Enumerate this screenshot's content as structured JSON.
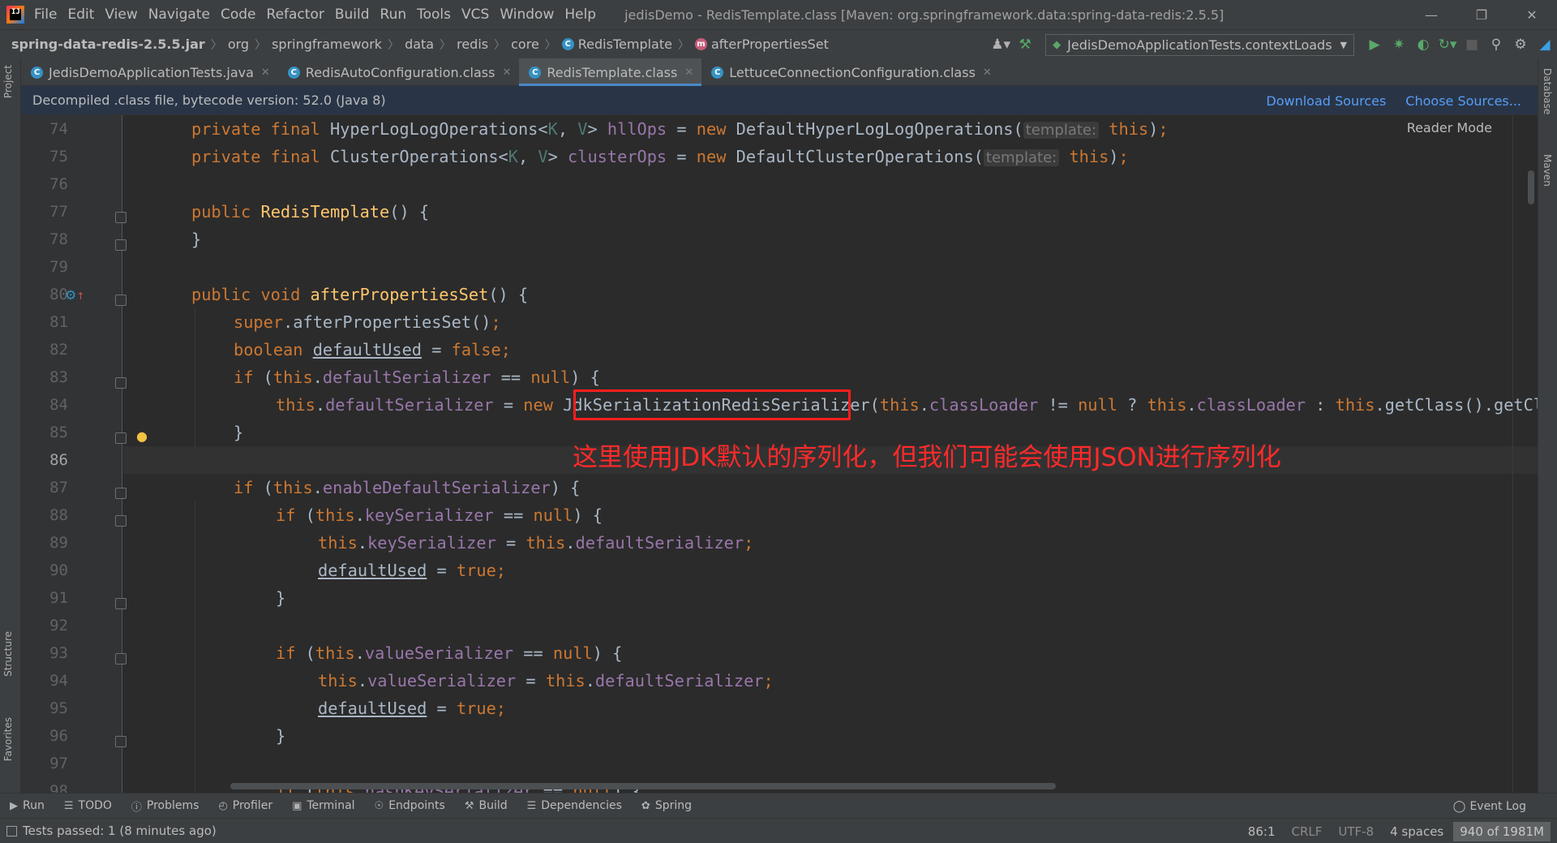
{
  "menubar": {
    "items": [
      "File",
      "Edit",
      "View",
      "Navigate",
      "Code",
      "Refactor",
      "Build",
      "Run",
      "Tools",
      "VCS",
      "Window",
      "Help"
    ],
    "title": "jedisDemo - RedisTemplate.class [Maven: org.springframework.data:spring-data-redis:2.5.5]"
  },
  "breadcrumb": {
    "items": [
      "spring-data-redis-2.5.5.jar",
      "org",
      "springframework",
      "data",
      "redis",
      "core",
      "RedisTemplate",
      "afterPropertiesSet"
    ]
  },
  "run_config": {
    "label": "JedisDemoApplicationTests.contextLoads"
  },
  "tabs": [
    {
      "label": "JedisDemoApplicationTests.java"
    },
    {
      "label": "RedisAutoConfiguration.class"
    },
    {
      "label": "RedisTemplate.class"
    },
    {
      "label": "LettuceConnectionConfiguration.class"
    }
  ],
  "banner": {
    "text": "Decompiled .class file, bytecode version: 52.0 (Java 8)",
    "download": "Download Sources",
    "choose": "Choose Sources..."
  },
  "reader_mode": "Reader Mode",
  "side_tabs": {
    "project": "Project",
    "structure": "Structure",
    "favorites": "Favorites",
    "database": "Database",
    "maven": "Maven"
  },
  "line_numbers": [
    "74",
    "75",
    "76",
    "77",
    "78",
    "79",
    "80",
    "81",
    "82",
    "83",
    "84",
    "85",
    "86",
    "87",
    "88",
    "89",
    "90",
    "91",
    "92",
    "93",
    "94",
    "95",
    "96",
    "97",
    "98"
  ],
  "current_line": "86",
  "annotation": "这里使用JDK默认的序列化，但我们可能会使用JSON进行序列化",
  "hints": {
    "template": "template:"
  },
  "toolwindows": [
    "Run",
    "TODO",
    "Problems",
    "Profiler",
    "Terminal",
    "Endpoints",
    "Build",
    "Dependencies",
    "Spring"
  ],
  "event_log": "Event Log",
  "status": {
    "message": "Tests passed: 1 (8 minutes ago)",
    "position": "86:1",
    "line_sep": "CRLF",
    "encoding": "UTF-8",
    "indent": "4 spaces",
    "memory": "940 of 1981M"
  }
}
